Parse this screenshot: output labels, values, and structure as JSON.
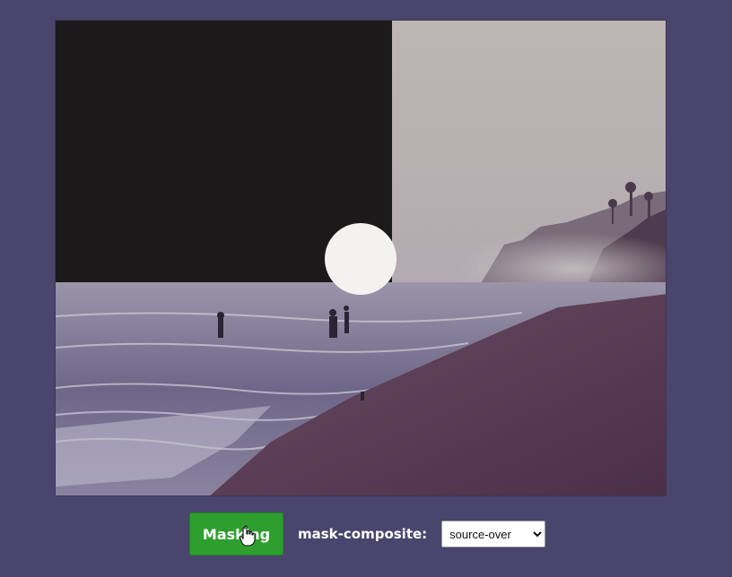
{
  "controls": {
    "masking_button_label": "Masking",
    "composite_label": "mask-composite:",
    "composite_selected": "source-over"
  },
  "canvas": {
    "dark_mask_color": "#1b1919",
    "circle_color": "#f4f2f0"
  }
}
